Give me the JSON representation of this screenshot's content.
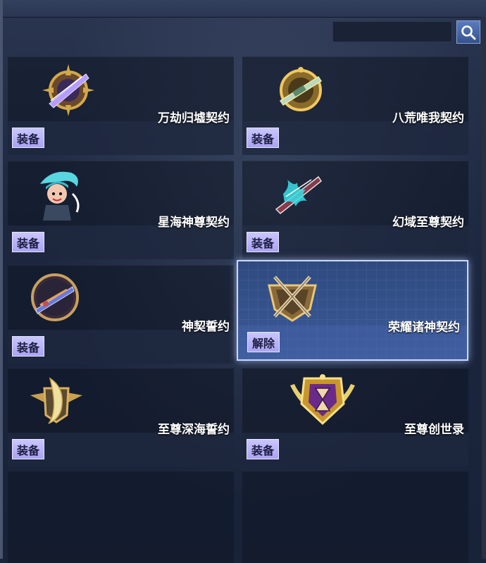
{
  "search": {
    "value": "",
    "placeholder": ""
  },
  "items": [
    {
      "name": "万劫归墟契约",
      "button": "装备",
      "icon": "purple-sword-emblem-icon"
    },
    {
      "name": "八荒唯我契约",
      "button": "装备",
      "icon": "golden-rifle-emblem-icon"
    },
    {
      "name": "星海神尊契约",
      "button": "装备",
      "icon": "teal-hair-character-icon"
    },
    {
      "name": "幻域至尊契约",
      "button": "装备",
      "icon": "cyan-dragon-blade-icon"
    },
    {
      "name": "神契誓约",
      "button": "装备",
      "icon": "circular-weapon-badge-icon"
    },
    {
      "name": "荣耀诸神契约",
      "button": "解除",
      "icon": "crossed-swords-shield-icon",
      "selected": true
    },
    {
      "name": "至尊深海誓约",
      "button": "装备",
      "icon": "golden-wing-shield-icon"
    },
    {
      "name": "至尊创世录",
      "button": "装备",
      "icon": "hourglass-laurel-badge-icon"
    }
  ],
  "colors": {
    "selected_border": "#c9d8ff",
    "button_bg": "#b7b1f8",
    "search_button": "#4a6ab0"
  }
}
